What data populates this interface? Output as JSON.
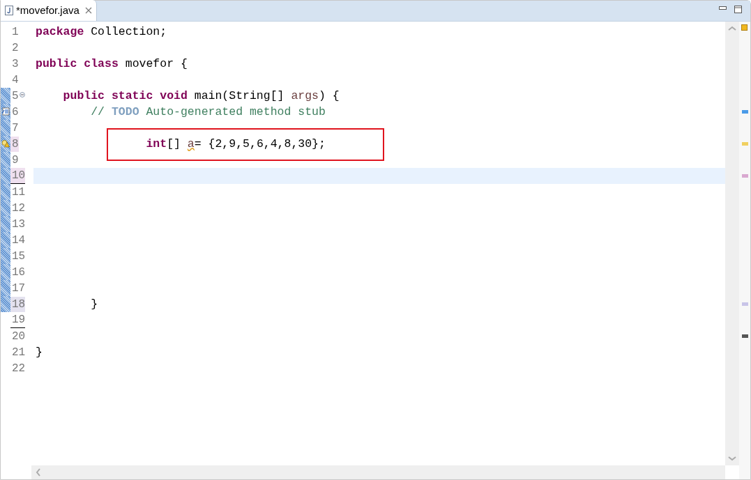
{
  "tab": {
    "title": "*movefor.java",
    "selected": true
  },
  "lines": [
    {
      "number": "1",
      "tokens": [
        {
          "text": "package",
          "kind": "keyword"
        },
        {
          "text": " Collection;",
          "kind": "plain"
        }
      ]
    },
    {
      "number": "2"
    },
    {
      "number": "3",
      "tokens": [
        {
          "text": "public class",
          "kind": "keyword"
        },
        {
          "text": " movefor {",
          "kind": "plain"
        }
      ]
    },
    {
      "number": "4"
    },
    {
      "number": "5",
      "tokens": [
        {
          "text": "    public static void",
          "kind": "keyword"
        },
        {
          "text": " main(String[] ",
          "kind": "plain"
        },
        {
          "text": "args",
          "kind": "param"
        },
        {
          "text": ") {",
          "kind": "plain"
        }
      ],
      "in_range": true,
      "foldable": true
    },
    {
      "number": "6",
      "tokens": [
        {
          "text": "        // ",
          "kind": "comment"
        },
        {
          "text": "TODO",
          "kind": "todo"
        },
        {
          "text": " Auto-generated method stub",
          "kind": "comment"
        }
      ],
      "in_range": true,
      "marker": {
        "kind": "task"
      },
      "color": "#4a9be8"
    },
    {
      "number": "7",
      "in_range": true
    },
    {
      "number": "8",
      "tokens": [
        {
          "text": "                int",
          "kind": "keyword"
        },
        {
          "text": "[] ",
          "kind": "plain"
        },
        {
          "text": "a",
          "kind": "warning"
        },
        {
          "text": "= {2,9,5,6,4,8,30};",
          "kind": "plain"
        }
      ],
      "in_range": true,
      "marker": {
        "kind": "warning"
      },
      "number_shaded": true,
      "boxed": true,
      "color": "#f0d060"
    },
    {
      "number": "9",
      "in_range": true
    },
    {
      "number": "10",
      "in_range": true,
      "current": true,
      "number_shaded": true,
      "number_underlined": true,
      "color": "#d9a8d0"
    },
    {
      "number": "11",
      "in_range": true
    },
    {
      "number": "12",
      "in_range": true
    },
    {
      "number": "13",
      "in_range": true
    },
    {
      "number": "14",
      "in_range": true
    },
    {
      "number": "15",
      "in_range": true
    },
    {
      "number": "16",
      "in_range": true
    },
    {
      "number": "17",
      "in_range": true
    },
    {
      "number": "18",
      "tokens": [
        {
          "text": "        }",
          "kind": "plain"
        }
      ],
      "in_range": true,
      "number_shaded": true,
      "color": "#c8c4e8"
    },
    {
      "number": "19",
      "number_underlined": true
    },
    {
      "number": "20",
      "color": "#555555"
    },
    {
      "number": "21",
      "tokens": [
        {
          "text": "}",
          "kind": "plain"
        }
      ]
    },
    {
      "number": "22"
    }
  ]
}
